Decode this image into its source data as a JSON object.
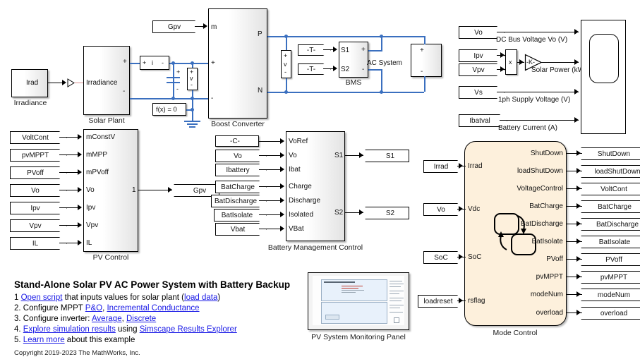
{
  "model": {
    "title": "Stand-Alone Solar PV AC Power System with Battery Backup"
  },
  "plant": {
    "irradiance_source_block": {
      "name": "Irradiance",
      "port": "Irad"
    },
    "solar_plant_block": {
      "name": "Solar Plant",
      "in_port": "Irradiance",
      "plus": "+",
      "minus": "-"
    },
    "current_sensor": {
      "plus": "+",
      "label": "i",
      "minus": "-"
    },
    "voltage_sensor_pv": {
      "plus": "+",
      "label": "v",
      "minus": "-"
    },
    "voltage_sensor_bus": {
      "plus": "+",
      "label": "v",
      "minus": "-"
    },
    "capacitor": {
      "plus": "+",
      "minus": "-"
    },
    "solver_block": {
      "label": "f(x) = 0"
    },
    "boost_converter": {
      "name": "Boost Converter",
      "in_m": "m",
      "in_plus": "+",
      "in_minus": "-",
      "out_p": "P",
      "out_n": "N"
    },
    "gpv_tag": "Gpv",
    "bms": {
      "name": "BMS",
      "in1": "S1",
      "in2": "S2",
      "out_plus": "+",
      "out_minus": "-",
      "tag1": "-T-",
      "tag2": "-T-"
    },
    "ac_system": {
      "label": "AC System",
      "plus": "+",
      "minus": "-"
    }
  },
  "monitor": {
    "signals": [
      {
        "tag": "Vo",
        "caption": "DC Bus Voltage Vo (V)"
      },
      {
        "tag": "Ipv",
        "caption": ""
      },
      {
        "tag": "Vpv",
        "caption": ""
      },
      {
        "tag": "Vs",
        "caption": "1ph Supply Voltage (V)"
      },
      {
        "tag": "Ibatval",
        "caption": "Battery Current (A)"
      }
    ],
    "product_block": "x",
    "gain_block": "-K-",
    "power_caption": "Solar Power (kW)"
  },
  "pv_control": {
    "name": "PV Control",
    "inputs": [
      {
        "tag": "VoltCont",
        "port": "mConstV"
      },
      {
        "tag": "pvMPPT",
        "port": "mMPP"
      },
      {
        "tag": "PVoff",
        "port": "mPVoff"
      },
      {
        "tag": "Vo",
        "port": "Vo"
      },
      {
        "tag": "Ipv",
        "port": "Ipv"
      },
      {
        "tag": "Vpv",
        "port": "Vpv"
      },
      {
        "tag": "IL",
        "port": "IL"
      }
    ],
    "output_port": "1",
    "output_tag": "Gpv"
  },
  "battery_management": {
    "name": "Battery Management Control",
    "inputs": [
      {
        "tag": "-C-",
        "port": "VoRef",
        "shape": "const"
      },
      {
        "tag": "Vo",
        "port": "Vo"
      },
      {
        "tag": "Ibattery",
        "port": "Ibat"
      },
      {
        "tag": "BatCharge",
        "port": "Charge"
      },
      {
        "tag": "BatDischarge",
        "port": "Discharge"
      },
      {
        "tag": "BatIsolate",
        "port": "Isolated"
      },
      {
        "tag": "Vbat",
        "port": "VBat"
      }
    ],
    "outputs": [
      {
        "port": "S1",
        "tag": "S1"
      },
      {
        "port": "S2",
        "tag": "S2"
      }
    ]
  },
  "mode_control": {
    "name": "Mode Control",
    "inputs": [
      {
        "tag": "Irrad",
        "port": "Irrad"
      },
      {
        "tag": "Vo",
        "port": "Vdc"
      },
      {
        "tag": "SoC",
        "port": "SoC"
      },
      {
        "tag": "loadreset",
        "port": "rsflag"
      }
    ],
    "outputs": [
      {
        "port": "ShutDown",
        "tag": "ShutDown"
      },
      {
        "port": "loadShutDown",
        "tag": "loadShutDown"
      },
      {
        "port": "VoltageControl",
        "tag": "VoltCont"
      },
      {
        "port": "BatCharge",
        "tag": "BatCharge"
      },
      {
        "port": "BatDischarge",
        "tag": "BatDischarge"
      },
      {
        "port": "BatIsolate",
        "tag": "BatIsolate"
      },
      {
        "port": "PVoff",
        "tag": "PVoff"
      },
      {
        "port": "pvMPPT",
        "tag": "pvMPPT"
      },
      {
        "port": "modeNum",
        "tag": "modeNum"
      },
      {
        "port": "overload",
        "tag": "overload"
      }
    ],
    "chart_bg": "#fdf0dc"
  },
  "panel": {
    "name": "PV System Monitoring Panel"
  },
  "annotation": {
    "title": "Stand-Alone Solar PV AC Power System with Battery Backup",
    "steps": [
      {
        "num": "1",
        "parts": [
          {
            "t": "Open script",
            "link": true
          },
          {
            "t": " that inputs values for solar plant (",
            "link": false
          },
          {
            "t": "load data",
            "link": true
          },
          {
            "t": ")",
            "link": false
          }
        ]
      },
      {
        "num": "2.",
        "parts": [
          {
            "t": "Configure MPPT ",
            "link": false
          },
          {
            "t": "P&O",
            "link": true
          },
          {
            "t": ", ",
            "link": false
          },
          {
            "t": "Incremental Conductance",
            "link": true
          }
        ]
      },
      {
        "num": "3.",
        "parts": [
          {
            "t": "Configure inverter: ",
            "link": false
          },
          {
            "t": "Average",
            "link": true
          },
          {
            "t": ", ",
            "link": false
          },
          {
            "t": "Discrete",
            "link": true
          }
        ]
      },
      {
        "num": "4.",
        "parts": [
          {
            "t": "Explore simulation results",
            "link": true
          },
          {
            "t": " using ",
            "link": false
          },
          {
            "t": "Simscape Results Explorer",
            "link": true
          }
        ]
      },
      {
        "num": "5.",
        "parts": [
          {
            "t": "Learn more",
            "link": true
          },
          {
            "t": " about this example",
            "link": false
          }
        ]
      }
    ],
    "copyright": "Copyright 2019-2023 The MathWorks, Inc."
  },
  "colors": {
    "physical_wire": "#3a6fbf",
    "signal_wire": "#000000",
    "link": "#1a1ae6",
    "chart_fill": "#fdf0dc"
  }
}
